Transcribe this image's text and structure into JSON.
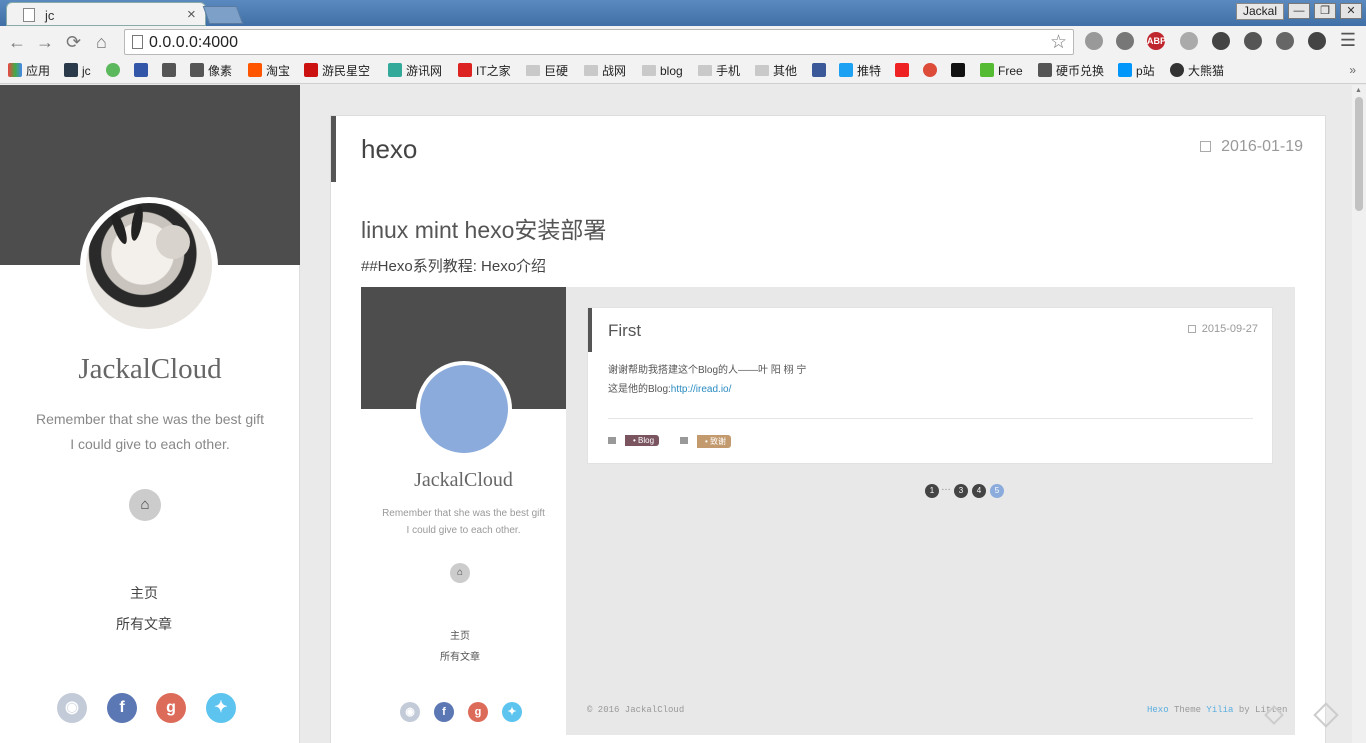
{
  "browser": {
    "tab_title": "jc",
    "tab_close": "×",
    "profile_name": "Jackal",
    "window_buttons": [
      "—",
      "❐",
      "✕"
    ],
    "url": "0.0.0.0:4000",
    "nav": {
      "back": "←",
      "forward": "→",
      "reload": "⟳",
      "home": "⌂"
    },
    "star": "☆",
    "extensions": [
      "ABP"
    ],
    "menu": "☰",
    "bookmarks": [
      "应用",
      "jc",
      "像素",
      "淘宝",
      "游民星空",
      "游讯网",
      "IT之家",
      "巨硬",
      "战网",
      "blog",
      "手机",
      "其他",
      "推特",
      "Free",
      "硬币兑换",
      "p站",
      "大熊猫"
    ],
    "bookmarks_more": "»"
  },
  "sidebar": {
    "title": "JackalCloud",
    "subtitle_1": "Remember that she was the best gift",
    "subtitle_2": "I could give to each other.",
    "nav": [
      "主页",
      "所有文章"
    ],
    "social": [
      "github",
      "facebook",
      "google-plus",
      "twitter"
    ]
  },
  "article": {
    "category": "hexo",
    "date": "2016-01-19",
    "heading": "linux mint hexo安装部署",
    "line": "##Hexo系列教程: Hexo介绍"
  },
  "screenshot": {
    "title": "JackalCloud",
    "subtitle_1": "Remember that she was the best gift",
    "subtitle_2": "I could give to each other.",
    "nav": [
      "主页",
      "所有文章"
    ],
    "post_title": "First",
    "post_date": "2015-09-27",
    "post_text_1": "谢谢帮助我搭建这个Blog的人——叶 阳 栩 宁",
    "post_text_2_prefix": "这是他的Blog:",
    "post_link": "http://iread.io/",
    "tag_1": "Blog",
    "tag_2": "致谢",
    "pages": [
      "1",
      "…",
      "3",
      "4",
      "5"
    ],
    "footer_left": "© 2016 JackalCloud",
    "footer_hexo": "Hexo",
    "footer_theme": " Theme ",
    "footer_yilia": "Yilia",
    "footer_by": " by Litten"
  },
  "colors": {
    "cover": "#4d4d4d",
    "facebook": "#5b77b4",
    "google": "#dd6b5a",
    "twitter": "#5cc4ee",
    "github": "#c3cbd8",
    "tag_blog": "#7a5560",
    "tag_thanks": "#c29a6e",
    "page_active": "#8aabdc"
  }
}
